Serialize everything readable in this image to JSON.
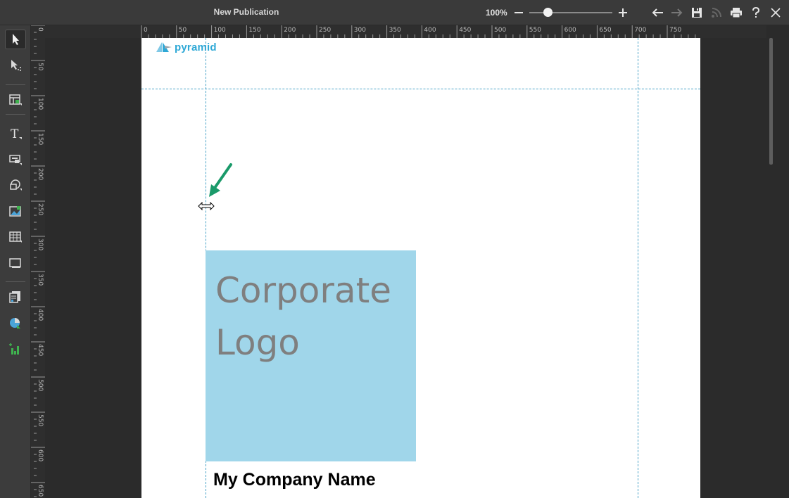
{
  "window": {
    "title": "New Publication",
    "zoom_label": "100%"
  },
  "topbar_icons": [
    "zoom-out-icon",
    "zoom-in-icon",
    "undo-arrow-icon",
    "redo-arrow-icon",
    "save-icon",
    "rss-feed-icon",
    "print-icon",
    "help-icon",
    "close-icon"
  ],
  "toolbar": {
    "tools": [
      "select-arrow",
      "direct-select-arrow",
      "layout-template",
      "text",
      "text-box",
      "shape",
      "image",
      "table",
      "frame",
      "page-report",
      "chart-pie",
      "chart-bar"
    ]
  },
  "ruler": {
    "horizontal_labels": [
      "0",
      "50",
      "100",
      "150",
      "200",
      "250",
      "300",
      "350",
      "400",
      "450",
      "500",
      "550",
      "600",
      "650",
      "700",
      "750"
    ],
    "vertical_labels": [
      "0",
      "50",
      "100",
      "150",
      "200",
      "250",
      "300",
      "350",
      "400",
      "450",
      "500",
      "550",
      "600",
      "650"
    ]
  },
  "page": {
    "brand_name": "pyramid",
    "logo_placeholder_line1": "Corporate",
    "logo_placeholder_line2": "Logo",
    "company_name": "My Company Name"
  },
  "colors": {
    "accent": "#2ea8d6",
    "logo_box": "#a0d6ea",
    "guide": "#4aa3c8",
    "arrow_annotation": "#1a9a6a"
  }
}
